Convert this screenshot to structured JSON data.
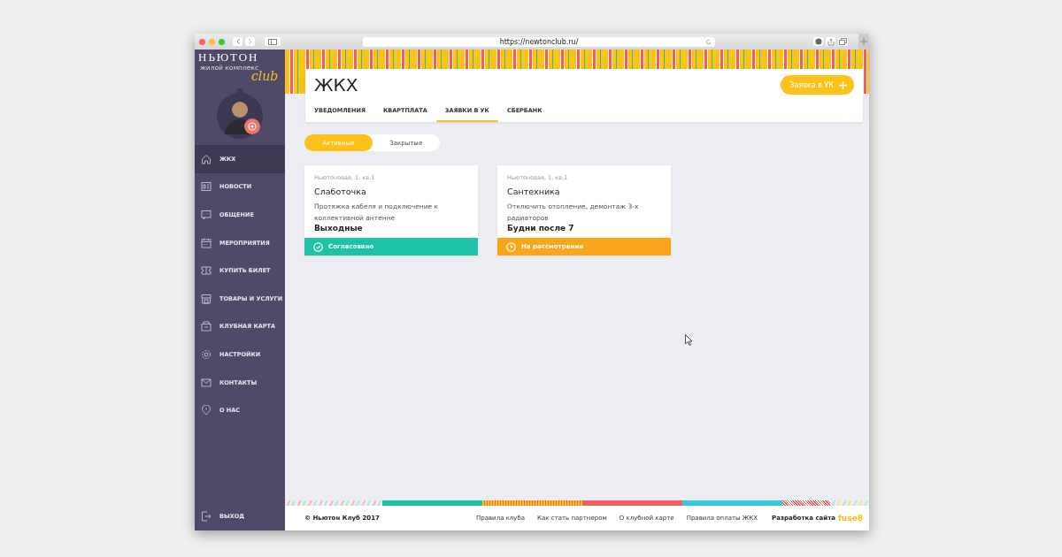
{
  "browser": {
    "url": "https://newtonclub.ru/"
  },
  "sidebar": {
    "logo": {
      "title": "НЬЮТОН",
      "subtitle": "жилой комплекс",
      "script": "club"
    },
    "items": [
      {
        "label": "ЖКХ",
        "selected": true
      },
      {
        "label": "НОВОСТИ",
        "selected": false
      },
      {
        "label": "ОБЩЕНИЕ",
        "selected": false
      },
      {
        "label": "МЕРОПРИЯТИЯ",
        "selected": false
      },
      {
        "label": "КУПИТЬ БИЛЕТ",
        "selected": false
      },
      {
        "label": "ТОВАРЫ И УСЛУГИ",
        "selected": false
      },
      {
        "label": "КЛУБНАЯ КАРТА",
        "selected": false
      },
      {
        "label": "НАСТРОЙКИ",
        "selected": false
      },
      {
        "label": "КОНТАКТЫ",
        "selected": false
      },
      {
        "label": "О НАС",
        "selected": false
      }
    ],
    "logout": "ВЫХОД"
  },
  "header": {
    "title": "ЖКХ",
    "button": "Заявка в УК",
    "tabs": [
      {
        "label": "УВЕДОМЛЕНИЯ",
        "selected": false
      },
      {
        "label": "КВАРТПЛАТА",
        "selected": false
      },
      {
        "label": "ЗАЯВКИ В УК",
        "selected": true
      },
      {
        "label": "СБЕРБАНК",
        "selected": false
      }
    ]
  },
  "filter": [
    {
      "label": "Активные",
      "selected": true
    },
    {
      "label": "Закрытые",
      "selected": false
    }
  ],
  "cards": [
    {
      "address": "Ньютоновая, 1, кв.1",
      "category": "Слаботочка",
      "description": "Протяжка кабеля и подключение к коллективной антенне",
      "schedule": "Выходные",
      "status": {
        "label": "Согласовано",
        "kind": "approved"
      }
    },
    {
      "address": "Ньютоновая, 1, кв.1",
      "category": "Сантехника",
      "description": "Отключить отопление, демонтаж 3-х радиаторов",
      "schedule": "Будни после 7",
      "status": {
        "label": "На рассмотрении",
        "kind": "review"
      }
    }
  ],
  "footer": {
    "copyright": "© Ньютон Клуб 2017",
    "links": [
      "Правила клуба",
      "Как стать партнером",
      "О клубной карте",
      "Правила оплаты ЖКХ"
    ],
    "developer": "Разработка сайта",
    "developer_logo": "fuse8"
  }
}
